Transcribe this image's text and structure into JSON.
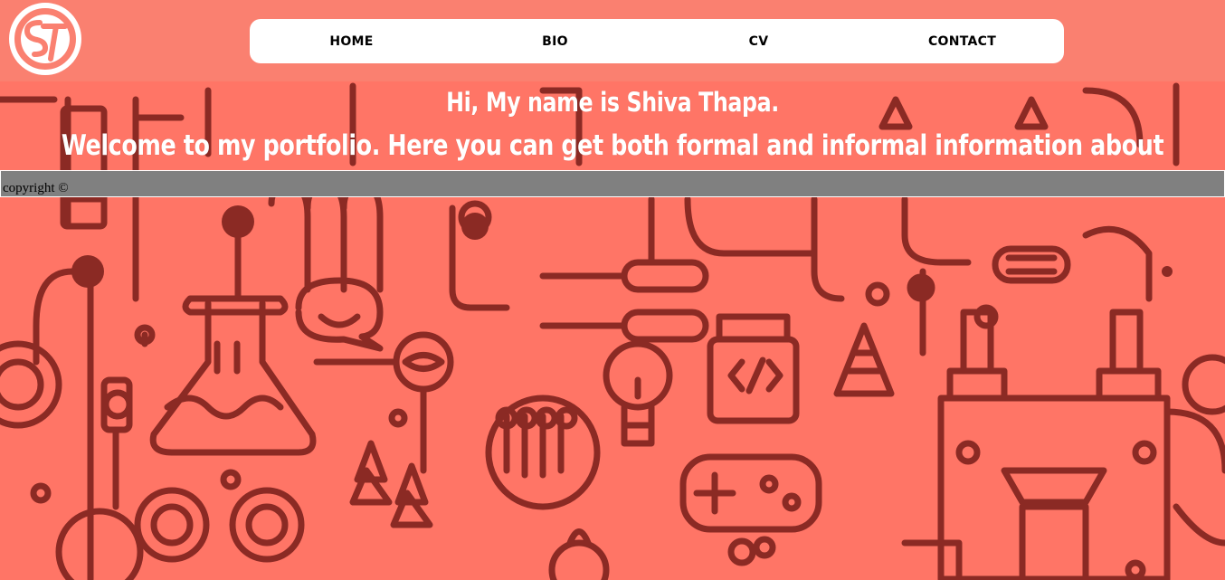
{
  "header": {
    "logo_text": "ST"
  },
  "nav": {
    "items": [
      {
        "label": "HOME"
      },
      {
        "label": "BIO"
      },
      {
        "label": "CV"
      },
      {
        "label": "CONTACT"
      }
    ]
  },
  "hero": {
    "greeting": "Hi, My name is Shiva Thapa.",
    "welcome": "Welcome to my portfolio. Here you can get both formal and informal information about me."
  },
  "footer": {
    "copyright": "copyright ©"
  },
  "colors": {
    "header_bg": "#fa8070",
    "page_bg": "#ff7566",
    "doodle_line": "#8b2a24",
    "footer_bg": "#808080"
  }
}
